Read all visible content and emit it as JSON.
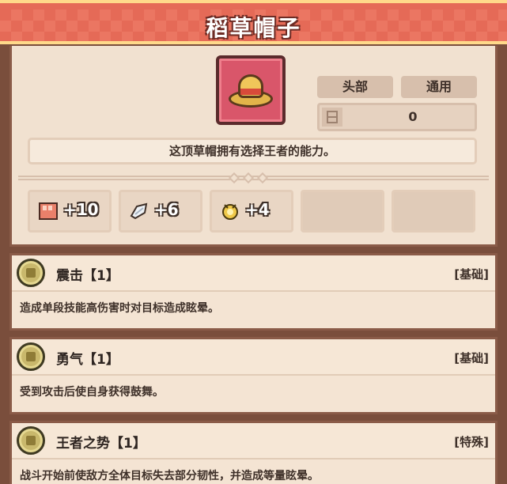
{
  "item": {
    "title": "稻草帽子",
    "slot": "头部",
    "category": "通用",
    "value": "0",
    "description": "这顶草帽拥有选择王者的能力。",
    "icon": "straw-hat-icon"
  },
  "stats": [
    {
      "icon": "fist-icon",
      "value": "+10"
    },
    {
      "icon": "wing-icon",
      "value": "+6"
    },
    {
      "icon": "gold-bell-icon",
      "value": "+4"
    },
    {
      "icon": "",
      "value": ""
    },
    {
      "icon": "",
      "value": ""
    }
  ],
  "skills": [
    {
      "name": "震击【1】",
      "type": "[基础]",
      "description": "造成单段技能高伤害时对目标造成眩晕。"
    },
    {
      "name": "勇气【1】",
      "type": "[基础]",
      "description": "受到攻击后使自身获得鼓舞。"
    },
    {
      "name": "王者之势【1】",
      "type": "[特殊]",
      "description": "战斗开始前使敌方全体目标失去部分韧性，并造成等量眩晕。"
    }
  ],
  "colors": {
    "banner": "#e56a57",
    "panel": "#f1e1d0",
    "frame": "#8a5b48",
    "item_icon_bg": "#d9566a"
  }
}
